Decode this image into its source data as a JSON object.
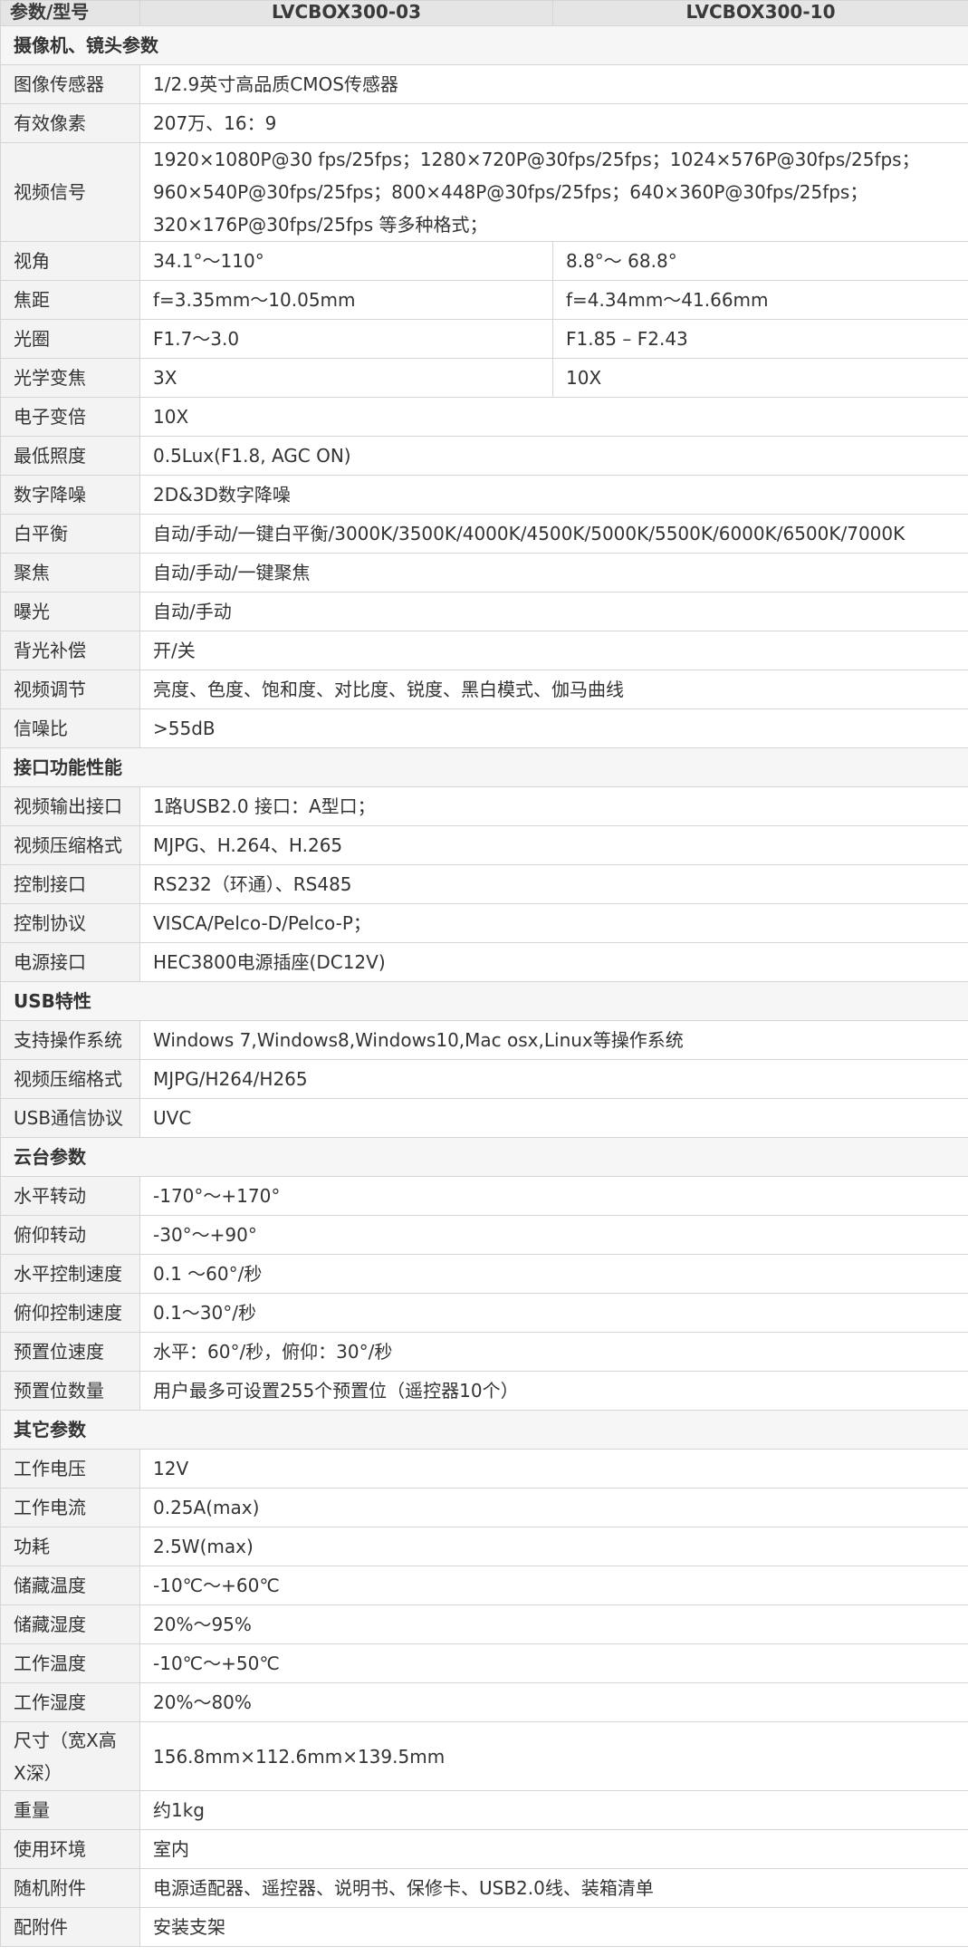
{
  "header": {
    "param_label": "参数/型号",
    "model_a": "LVCBOX300-03",
    "model_b": "LVCBOX300-10"
  },
  "sections": [
    {
      "title": "摄像机、镜头参数",
      "rows": [
        {
          "label": "图像传感器",
          "value": "1/2.9英寸高品质CMOS传感器"
        },
        {
          "label": "有效像素",
          "value": "207万、16：9"
        },
        {
          "label": "视频信号",
          "value": "1920×1080P@30 fps/25fps；1280×720P@30fps/25fps；1024×576P@30fps/25fps； 960×540P@30fps/25fps；800×448P@30fps/25fps；640×360P@30fps/25fps； 320×176P@30fps/25fps 等多种格式；"
        },
        {
          "label": "视角",
          "value_a": "34.1°～110°",
          "value_b": "8.8°～ 68.8°"
        },
        {
          "label": "焦距",
          "value_a": "f=3.35mm～10.05mm",
          "value_b": "f=4.34mm～41.66mm"
        },
        {
          "label": "光圈",
          "value_a": "F1.7～3.0",
          "value_b": "F1.85 – F2.43"
        },
        {
          "label": "光学变焦",
          "value_a": "3X",
          "value_b": "10X"
        },
        {
          "label": "电子变倍",
          "value": "10X"
        },
        {
          "label": "最低照度",
          "value": "0.5Lux(F1.8, AGC ON)"
        },
        {
          "label": "数字降噪",
          "value": "2D&3D数字降噪"
        },
        {
          "label": "白平衡",
          "value": "自动/手动/一键白平衡/3000K/3500K/4000K/4500K/5000K/5500K/6000K/6500K/7000K"
        },
        {
          "label": "聚焦",
          "value": "自动/手动/一键聚焦"
        },
        {
          "label": "曝光",
          "value": "自动/手动"
        },
        {
          "label": "背光补偿",
          "value": "开/关"
        },
        {
          "label": "视频调节",
          "value": "亮度、色度、饱和度、对比度、锐度、黑白模式、伽马曲线"
        },
        {
          "label": "信噪比",
          "value": ">55dB"
        }
      ]
    },
    {
      "title": "接口功能性能",
      "rows": [
        {
          "label": "视频输出接口",
          "value": "1路USB2.0 接口：A型口；"
        },
        {
          "label": "视频压缩格式",
          "value": "MJPG、H.264、H.265"
        },
        {
          "label": "控制接口",
          "value": "RS232（环通）、RS485"
        },
        {
          "label": "控制协议",
          "value": "VISCA/Pelco-D/Pelco-P；"
        },
        {
          "label": "电源接口",
          "value": "HEC3800电源插座(DC12V)"
        }
      ]
    },
    {
      "title": "USB特性",
      "rows": [
        {
          "label": "支持操作系统",
          "value": "Windows 7,Windows8,Windows10,Mac osx,Linux等操作系统"
        },
        {
          "label": "视频压缩格式",
          "value": "MJPG/H264/H265"
        },
        {
          "label": "USB通信协议",
          "value": "UVC"
        }
      ]
    },
    {
      "title": "云台参数",
      "rows": [
        {
          "label": "水平转动",
          "value": "-170°～+170°"
        },
        {
          "label": "俯仰转动",
          "value": "-30°～+90°"
        },
        {
          "label": "水平控制速度",
          "value": "0.1 ～60°/秒"
        },
        {
          "label": "俯仰控制速度",
          "value": "0.1～30°/秒"
        },
        {
          "label": "预置位速度",
          "value": "水平：60°/秒，俯仰：30°/秒"
        },
        {
          "label": "预置位数量",
          "value": "用户最多可设置255个预置位（遥控器10个）"
        }
      ]
    },
    {
      "title": "其它参数",
      "rows": [
        {
          "label": "工作电压",
          "value": "12V"
        },
        {
          "label": "工作电流",
          "value": "0.25A(max)"
        },
        {
          "label": "功耗",
          "value": "2.5W(max)"
        },
        {
          "label": "储藏温度",
          "value": "-10℃～+60℃"
        },
        {
          "label": "储藏湿度",
          "value": "20%～95%"
        },
        {
          "label": "工作温度",
          "value": "-10℃～+50℃"
        },
        {
          "label": "工作湿度",
          "value": "20%～80%"
        },
        {
          "label": "尺寸（宽X高X深）",
          "value": "156.8mm×112.6mm×139.5mm"
        },
        {
          "label": "重量",
          "value": "约1kg"
        },
        {
          "label": "使用环境",
          "value": "室内"
        },
        {
          "label": "随机附件",
          "value": "电源适配器、遥控器、说明书、保修卡、USB2.0线、装箱清单"
        },
        {
          "label": "配附件",
          "value": "安装支架"
        }
      ]
    }
  ]
}
